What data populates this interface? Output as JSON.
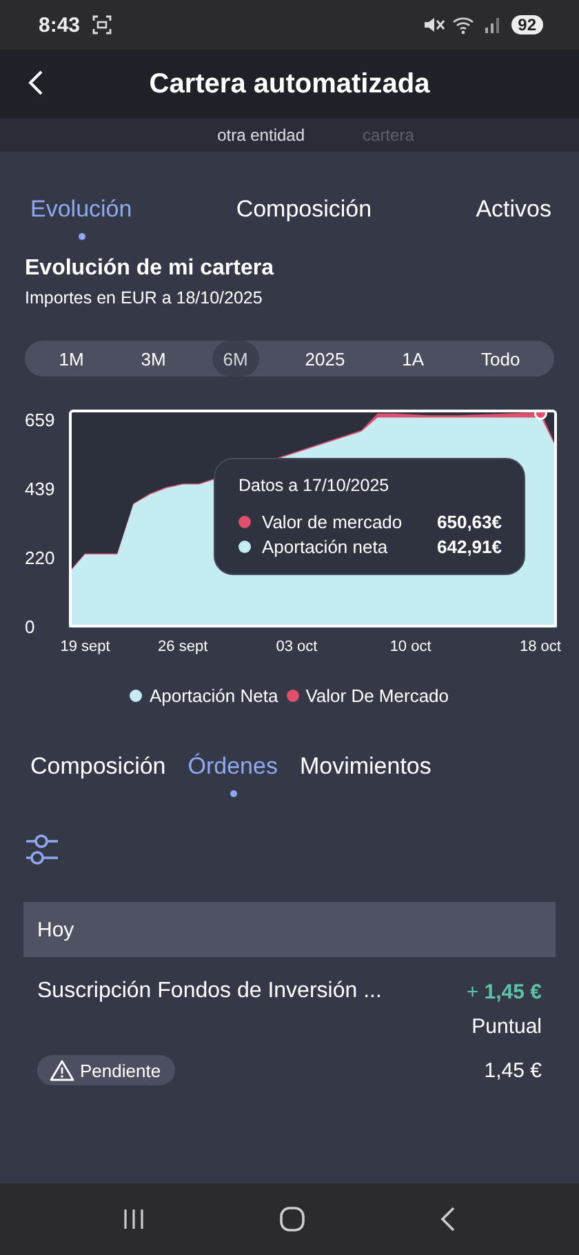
{
  "status_bar": {
    "time": "8:43",
    "battery": "92"
  },
  "header": {
    "title": "Cartera automatizada"
  },
  "faded_row": [
    "otra entidad",
    "cartera"
  ],
  "tabs": [
    {
      "label": "Evolución",
      "selected": true
    },
    {
      "label": "Composición",
      "selected": false
    },
    {
      "label": "Activos",
      "selected": false
    }
  ],
  "section": {
    "title": "Evolución de mi cartera",
    "subtitle": "Importes en EUR a 18/10/2025"
  },
  "ranges": [
    {
      "label": "1M",
      "selected": false
    },
    {
      "label": "3M",
      "selected": false
    },
    {
      "label": "6M",
      "selected": true
    },
    {
      "label": "2025",
      "selected": false
    },
    {
      "label": "1A",
      "selected": false
    },
    {
      "label": "Todo",
      "selected": false
    }
  ],
  "chart": {
    "chart_data": {
      "type": "area",
      "categories": [
        null,
        "19 sept",
        null,
        null,
        null,
        null,
        null,
        "26 sept",
        null,
        null,
        null,
        null,
        null,
        null,
        "03 oct",
        null,
        null,
        null,
        null,
        null,
        null,
        "10 oct",
        null,
        null,
        null,
        null,
        null,
        null,
        null,
        "18 oct",
        null
      ],
      "series": [
        {
          "name": "Aportación Neta",
          "color": "#c5ecf3",
          "values": [
            170,
            230,
            230,
            230,
            390,
            420,
            440,
            452,
            452,
            null,
            null,
            null,
            null,
            null,
            null,
            null,
            null,
            null,
            620,
            665,
            665,
            665,
            665,
            665,
            665,
            665,
            665,
            665,
            665,
            665,
            560
          ]
        },
        {
          "name": "Valor De Mercado",
          "color": "#e0506e",
          "values": [
            173,
            233,
            233,
            233,
            393,
            424,
            444,
            455,
            455,
            null,
            null,
            null,
            null,
            null,
            null,
            null,
            null,
            null,
            625,
            678,
            678,
            675,
            672,
            672,
            672,
            674,
            676,
            678,
            680,
            680,
            565
          ]
        }
      ],
      "ylim": [
        0,
        692
      ],
      "yticks": [
        0,
        220,
        439,
        659
      ]
    },
    "tooltip": {
      "title": "Datos a 17/10/2025",
      "rows": [
        {
          "label": "Valor de mercado",
          "value": "650,63€",
          "color": "#e0506e"
        },
        {
          "label": "Aportación neta",
          "value": "642,91€",
          "color": "#c5ecf3"
        }
      ]
    }
  },
  "sub_tabs": [
    {
      "label": "Composición",
      "selected": false
    },
    {
      "label": "Órdenes",
      "selected": true
    },
    {
      "label": "Movimientos",
      "selected": false
    }
  ],
  "group": {
    "title": "Hoy"
  },
  "order": {
    "name": "Suscripción Fondos de Inversión ...",
    "amount_sign": "+",
    "amount": "1,45 €",
    "frequency": "Puntual",
    "status": "Pendiente",
    "total": "1,45 €"
  }
}
